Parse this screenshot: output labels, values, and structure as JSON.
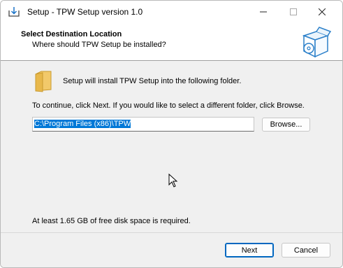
{
  "window": {
    "title": "Setup - TPW Setup version 1.0",
    "controls": {
      "minimize": "minimize-icon",
      "maximize": "maximize-icon",
      "close": "close-icon"
    }
  },
  "header": {
    "title": "Select Destination Location",
    "subtitle": "Where should TPW Setup be installed?"
  },
  "content": {
    "intro": "Setup will install TPW Setup into the following folder.",
    "instruction": "To continue, click Next. If you would like to select a different folder, click Browse.",
    "path_value": "C:\\Program Files (x86)\\TPW",
    "browse_label": "Browse...",
    "disk_space": "At least 1.65 GB of free disk space is required."
  },
  "footer": {
    "next_label": "Next",
    "cancel_label": "Cancel"
  },
  "colors": {
    "selection": "#0078d7",
    "default_button_border": "#0067c0",
    "folder": "#e8b84b"
  }
}
